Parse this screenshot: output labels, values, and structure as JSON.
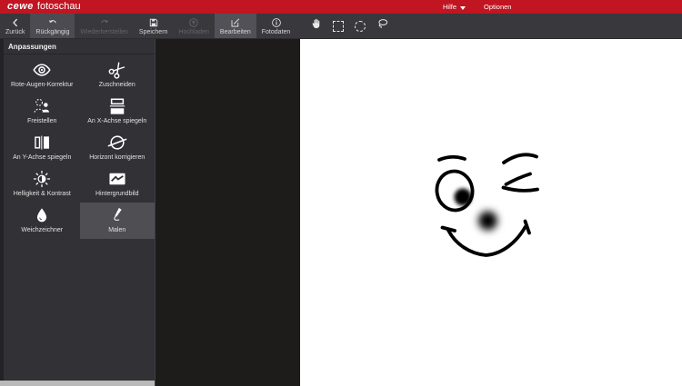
{
  "titlebar": {
    "logo": {
      "brand": "cewe",
      "product": "fotoschau"
    },
    "menu": [
      {
        "label": "Hilfe"
      },
      {
        "label": "Optionen"
      }
    ]
  },
  "toolbar": {
    "buttons": [
      {
        "label": "Zurück",
        "icon": "chevron-left-icon",
        "state": "normal"
      },
      {
        "label": "Rückgängig",
        "icon": "undo-icon",
        "state": "highlighted"
      },
      {
        "label": "Wiederherstellen",
        "icon": "redo-icon",
        "state": "disabled"
      },
      {
        "label": "Speichern",
        "icon": "save-icon",
        "state": "normal"
      },
      {
        "label": "Hochladen",
        "icon": "upload-icon",
        "state": "disabled"
      },
      {
        "label": "Bearbeiten",
        "icon": "edit-icon",
        "state": "selected"
      },
      {
        "label": "Fotodaten",
        "icon": "info-icon",
        "state": "normal"
      }
    ],
    "select_tools": [
      "hand",
      "rectangle-select",
      "ellipse-select",
      "lasso-select"
    ]
  },
  "sidebar": {
    "title": "Anpassungen",
    "items": [
      {
        "label": "Rote-Augen-Korrektur",
        "icon": "red-eye",
        "selected": false
      },
      {
        "label": "Zuschneiden",
        "icon": "scissors",
        "selected": false
      },
      {
        "label": "Freistellen",
        "icon": "cutout-person",
        "selected": false
      },
      {
        "label": "An X-Achse spiegeln",
        "icon": "flip-x",
        "selected": false
      },
      {
        "label": "An Y-Achse spiegeln",
        "icon": "flip-y",
        "selected": false
      },
      {
        "label": "Horizont korrigieren",
        "icon": "horizon",
        "selected": false
      },
      {
        "label": "Helligkeit & Kontrast",
        "icon": "brightness",
        "selected": false
      },
      {
        "label": "Hintergrundbild",
        "icon": "background-image",
        "selected": false
      },
      {
        "label": "Weichzeichner",
        "icon": "blur-drop",
        "selected": false
      },
      {
        "label": "Malen",
        "icon": "paint-pen",
        "selected": true
      }
    ]
  },
  "canvas": {
    "drawing": {
      "description": "hand-drawn winking smiley face (left eye open with pupil, right eye winking, blurred nose dot, wide smile)",
      "stroke_color": "#000000",
      "background": "#ffffff"
    }
  },
  "colors": {
    "brand_red": "#c11522",
    "toolbar_bg": "#38383d",
    "sidebar_bg": "#313136",
    "highlight_bg": "#4e4e53",
    "canvas_dark": "#1d1c1a",
    "scrollbar_gray": "#b9b9b9"
  }
}
